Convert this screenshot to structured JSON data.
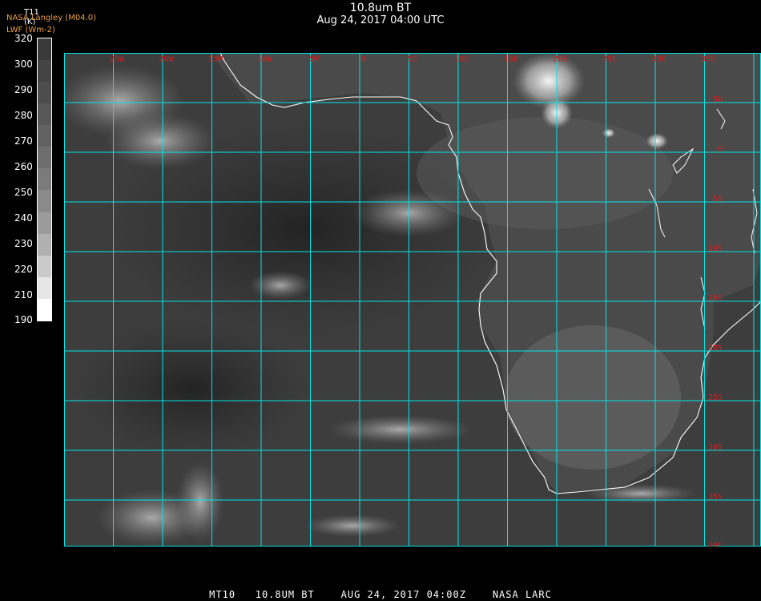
{
  "header": {
    "title": "10.8um BT",
    "datetime": "Aug 24, 2017 04:00 UTC"
  },
  "credits": {
    "source": "NASA Langley (M04.0)",
    "product": "LWF (Wm-2)"
  },
  "scale": {
    "variable": "T11",
    "unit": "(K)",
    "ticks": [
      "320",
      "300",
      "290",
      "280",
      "270",
      "260",
      "250",
      "240",
      "230",
      "220",
      "210",
      "190"
    ],
    "colors": [
      "#3a3a3a",
      "#444444",
      "#4d4d4d",
      "#575757",
      "#626262",
      "#6e6e6e",
      "#7b7b7b",
      "#8a8a8a",
      "#9b9b9b",
      "#b0b0b0",
      "#cacaca",
      "#e6e6e6",
      "#ffffff"
    ]
  },
  "map": {
    "lon_labels": [
      "25W",
      "20W",
      "15W",
      "10W",
      "5W",
      "0",
      "5E",
      "10E",
      "15E",
      "20E",
      "25E",
      "30E",
      "35E"
    ],
    "lat_labels": [
      "5N",
      "0",
      "5S",
      "10S",
      "15S",
      "20S",
      "25S",
      "30S",
      "35S",
      "40S"
    ],
    "grid_color": "#00e5e5",
    "coast_color": "#ffffff"
  },
  "footer": {
    "text": "MT10   10.8UM BT    AUG 24, 2017 04:00Z    NASA LARC"
  }
}
